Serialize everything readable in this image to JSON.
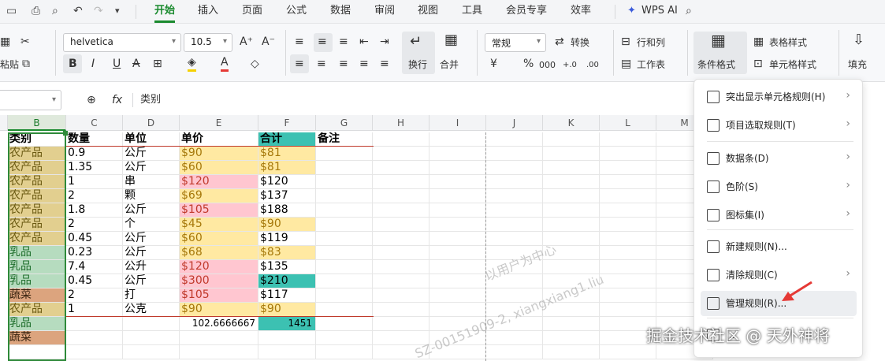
{
  "menubar": {
    "tabs": [
      "开始",
      "插入",
      "页面",
      "公式",
      "数据",
      "审阅",
      "视图",
      "工具",
      "会员专享",
      "效率"
    ],
    "active_tab": "开始",
    "wps_ai": "WPS AI"
  },
  "ribbon": {
    "font_name": "helvetica",
    "font_size": "10.5",
    "number_format": "常规",
    "convert": "转换",
    "wrap": "换行",
    "merge": "合并",
    "row_col": "行和列",
    "worksheet": "工作表",
    "cond_format": "条件格式",
    "table_style": "表格样式",
    "cell_style": "单元格样式",
    "fill": "填充",
    "paste_partial": "粘贴"
  },
  "formula_bar": {
    "fx": "fx",
    "content": "类别"
  },
  "columns": [
    "B",
    "C",
    "D",
    "E",
    "F",
    "G",
    "H",
    "I",
    "J",
    "K",
    "L",
    "M"
  ],
  "table": {
    "headers": [
      "类别",
      "数量",
      "单位",
      "单价",
      "合计",
      "备注"
    ],
    "rows": [
      [
        "农产品",
        "0.9",
        "公斤",
        "$90",
        "$81"
      ],
      [
        "农产品",
        "1.35",
        "公斤",
        "$60",
        "$81"
      ],
      [
        "农产品",
        "1",
        "串",
        "$120",
        "$120"
      ],
      [
        "农产品",
        "2",
        "颗",
        "$69",
        "$137"
      ],
      [
        "农产品",
        "1.8",
        "公斤",
        "$105",
        "$188"
      ],
      [
        "农产品",
        "2",
        "个",
        "$45",
        "$90"
      ],
      [
        "农产品",
        "0.45",
        "公斤",
        "$60",
        "$119"
      ],
      [
        "乳品",
        "0.23",
        "公斤",
        "$68",
        "$83"
      ],
      [
        "乳品",
        "7.4",
        "公升",
        "$120",
        "$135"
      ],
      [
        "乳品",
        "0.45",
        "公斤",
        "$300",
        "$210"
      ],
      [
        "蔬菜",
        "2",
        "打",
        "$105",
        "$117"
      ],
      [
        "农产品",
        "1",
        "公克",
        "$90",
        "$90"
      ]
    ],
    "total_avg": "102.6666667",
    "total_sum": "1451",
    "extra_b": [
      "乳品",
      "蔬菜"
    ]
  },
  "dropdown": {
    "items": [
      {
        "label": "突出显示单元格规则(H)",
        "icon": "highlight-rules-icon",
        "arrow": true
      },
      {
        "label": "项目选取规则(T)",
        "icon": "top-bottom-rules-icon",
        "arrow": true
      },
      {
        "label": "数据条(D)",
        "icon": "data-bars-icon",
        "arrow": true
      },
      {
        "label": "色阶(S)",
        "icon": "color-scales-icon",
        "arrow": true
      },
      {
        "label": "图标集(I)",
        "icon": "icon-sets-icon",
        "arrow": true
      },
      {
        "label": "新建规则(N)...",
        "icon": "new-rule-icon",
        "arrow": false
      },
      {
        "label": "清除规则(C)",
        "icon": "clear-rules-icon",
        "arrow": true
      },
      {
        "label": "管理规则(R)...",
        "icon": "manage-rules-icon",
        "arrow": false
      },
      {
        "label": "...",
        "icon": "more-icon",
        "arrow": false
      }
    ]
  },
  "watermark": {
    "center_a": "以用户为中心",
    "center_b": "SZ-00151909-2, xiangxiang1.liu",
    "credit": "掘金技术社区 @ 天外神将"
  },
  "colors": {
    "accent": "#1a8a2e",
    "farm": "#e2cf8f",
    "dairy": "#b6dcbf",
    "veg": "#dca47e",
    "yellow": "#ffe9a2",
    "pink": "#ffc6d0",
    "teal": "#3cc1b2"
  }
}
